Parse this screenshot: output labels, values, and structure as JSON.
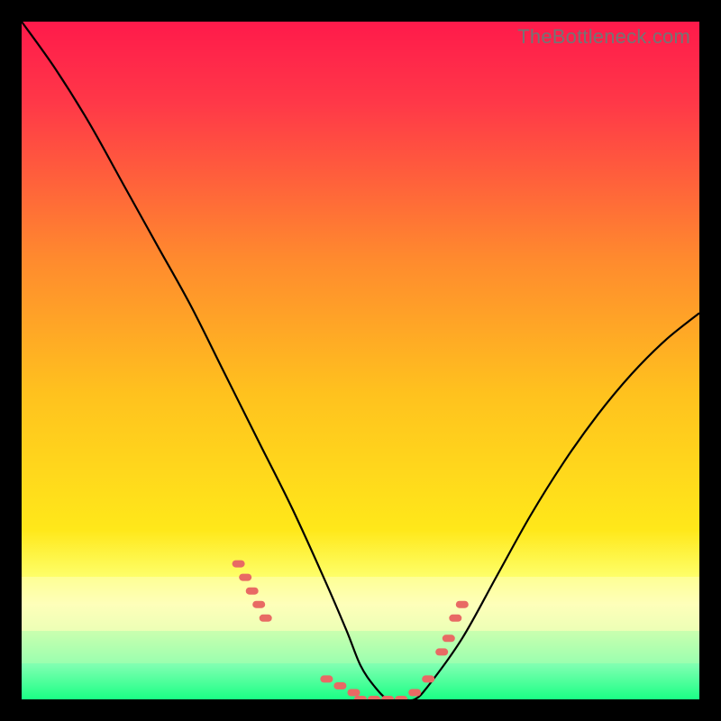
{
  "watermark": "TheBottleneck.com",
  "colors": {
    "page_bg": "#000000",
    "grad_top": "#ff1a4b",
    "grad_mid": "#ffd21a",
    "grad_bot": "#1aff85",
    "highlight_band_top": "#feffba",
    "highlight_band_bot": "#b7ffb0",
    "curve": "#000000",
    "dots": "#e86a64"
  },
  "chart_data": {
    "type": "line",
    "title": "",
    "xlabel": "",
    "ylabel": "",
    "xlim": [
      0,
      100
    ],
    "ylim": [
      0,
      100
    ],
    "grid": false,
    "legend": false,
    "annotations": [
      "TheBottleneck.com"
    ],
    "series": [
      {
        "name": "bottleneck-curve",
        "x": [
          0,
          5,
          10,
          15,
          20,
          25,
          30,
          35,
          40,
          45,
          48,
          50,
          52,
          54,
          56,
          58,
          60,
          65,
          70,
          75,
          80,
          85,
          90,
          95,
          100
        ],
        "y": [
          100,
          93,
          85,
          76,
          67,
          58,
          48,
          38,
          28,
          17,
          10,
          5,
          2,
          0,
          0,
          0,
          2,
          9,
          18,
          27,
          35,
          42,
          48,
          53,
          57
        ]
      }
    ],
    "highlight_points": {
      "name": "dot-cluster",
      "x": [
        32,
        33,
        34,
        35,
        36,
        45,
        47,
        49,
        50,
        52,
        54,
        56,
        58,
        60,
        62,
        63,
        64,
        65
      ],
      "y": [
        20,
        18,
        16,
        14,
        12,
        3,
        2,
        1,
        0,
        0,
        0,
        0,
        1,
        3,
        7,
        9,
        12,
        14
      ]
    },
    "highlight_band_y": [
      6,
      18
    ]
  }
}
